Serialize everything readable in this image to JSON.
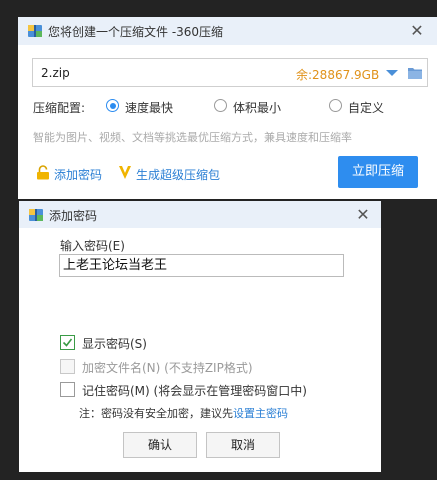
{
  "main_window": {
    "title": "您将创建一个压缩文件 -360压缩",
    "close": "✕",
    "filename": "2.zip",
    "free_space": "余:28867.9GB",
    "config_label": "压缩配置:",
    "options": [
      {
        "label": "速度最快",
        "selected": true
      },
      {
        "label": "体积最小",
        "selected": false
      },
      {
        "label": "自定义",
        "selected": false
      }
    ],
    "tip": "智能为图片、视频、文档等挑选最优压缩方式，兼具速度和压缩率",
    "add_password": "添加密码",
    "make_sfx": "生成超级压缩包",
    "compress_now": "立即压缩",
    "colors": {
      "accent": "#2e8def",
      "free_space": "#e0921a",
      "sfx_icon": "#f0b400",
      "lock_icon": "#f0b400"
    }
  },
  "password_dialog": {
    "title": "添加密码",
    "close": "✕",
    "input_label": "输入密码(E)",
    "input_value": "上老王论坛当老王",
    "options": [
      {
        "label": "显示密码(S)",
        "checked": true,
        "disabled": false
      },
      {
        "label": "加密文件名(N) (不支持ZIP格式)",
        "checked": false,
        "disabled": true
      },
      {
        "label": "记住密码(M) (将会显示在管理密码窗口中)",
        "checked": false,
        "disabled": false
      }
    ],
    "note_prefix": "注：密码没有安全加密，建议先",
    "note_link": "设置主密码",
    "ok": "确认",
    "cancel": "取消"
  }
}
